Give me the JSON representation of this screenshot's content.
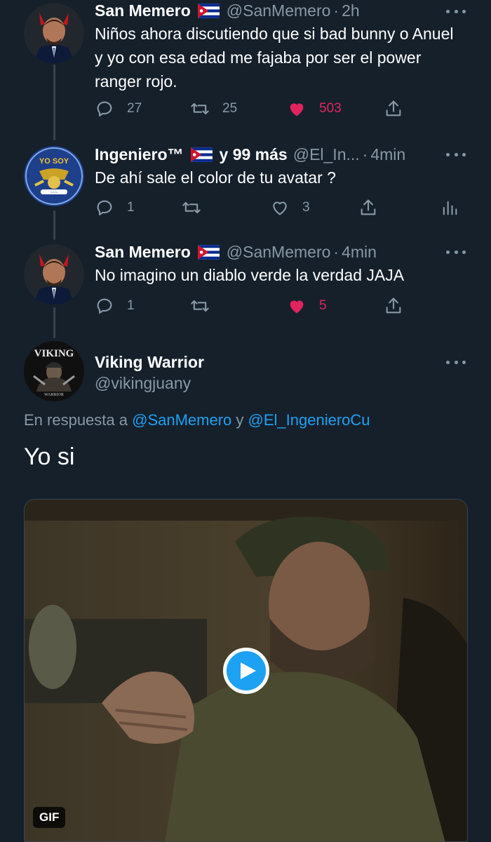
{
  "tweets": [
    {
      "name": "San Memero",
      "handle": "@SanMemero",
      "sep": "·",
      "time": "2h",
      "text": "Niños ahora discutiendo que si bad bunny o Anuel y yo con esa edad me fajaba por ser el power ranger rojo.",
      "replies": "27",
      "retweets": "25",
      "likes": "503",
      "liked": true,
      "avatar_icon": "devil-avatar-icon"
    },
    {
      "name": "Ingeniero™",
      "extra": "y 99 más",
      "handle": "@El_In...",
      "sep": "·",
      "time": "4min",
      "text": "De ahí sale el color de tu avatar ?",
      "replies": "1",
      "retweets": "",
      "likes": "3",
      "liked": false,
      "avatar_icon": "engineer-badge-avatar-icon",
      "avatar_text": "YO SOY"
    },
    {
      "name": "San Memero",
      "handle": "@SanMemero",
      "sep": "·",
      "time": "4min",
      "text": "No imagino un diablo verde la verdad JAJA",
      "replies": "1",
      "retweets": "",
      "likes": "5",
      "liked": true,
      "avatar_icon": "devil-avatar-icon"
    }
  ],
  "main_tweet": {
    "name": "Viking Warrior",
    "handle": "@vikingjuany",
    "avatar_text_top": "VIKING",
    "avatar_text_bottom": "WARRIOR",
    "reply_prefix": "En respuesta a",
    "reply_mention_1": "@SanMemero",
    "reply_joiner": "y",
    "reply_mention_2": "@El_IngenieroCu",
    "text": "Yo si",
    "media_badge": "GIF"
  },
  "colors": {
    "background": "#15202b",
    "secondary_text": "#8899a6",
    "like_red": "#e0245e",
    "link_blue": "#1da1f2"
  }
}
